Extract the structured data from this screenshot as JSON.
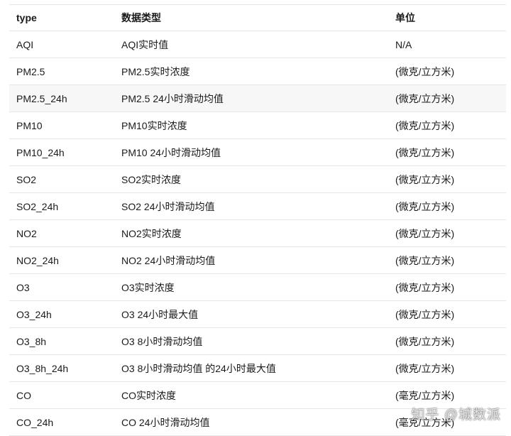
{
  "table": {
    "headers": [
      "type",
      "数据类型",
      "单位"
    ],
    "rows": [
      [
        "AQI",
        "AQI实时值",
        "N/A"
      ],
      [
        "PM2.5",
        "PM2.5实时浓度",
        "(微克/立方米)"
      ],
      [
        "PM2.5_24h",
        "PM2.5 24小时滑动均值",
        "(微克/立方米)"
      ],
      [
        "PM10",
        "PM10实时浓度",
        "(微克/立方米)"
      ],
      [
        "PM10_24h",
        "PM10 24小时滑动均值",
        "(微克/立方米)"
      ],
      [
        "SO2",
        "SO2实时浓度",
        "(微克/立方米)"
      ],
      [
        "SO2_24h",
        "SO2 24小时滑动均值",
        "(微克/立方米)"
      ],
      [
        "NO2",
        "NO2实时浓度",
        "(微克/立方米)"
      ],
      [
        "NO2_24h",
        "NO2 24小时滑动均值",
        "(微克/立方米)"
      ],
      [
        "O3",
        "O3实时浓度",
        "(微克/立方米)"
      ],
      [
        "O3_24h",
        "O3 24小时最大值",
        "(微克/立方米)"
      ],
      [
        "O3_8h",
        "O3 8小时滑动均值",
        "(微克/立方米)"
      ],
      [
        "O3_8h_24h",
        "O3 8小时滑动均值 的24小时最大值",
        "(微克/立方米)"
      ],
      [
        "CO",
        "CO实时浓度",
        "(毫克/立方米)"
      ],
      [
        "CO_24h",
        "CO 24小时滑动均值",
        "(毫克/立方米)"
      ]
    ]
  },
  "watermark": "知乎 @城数派"
}
